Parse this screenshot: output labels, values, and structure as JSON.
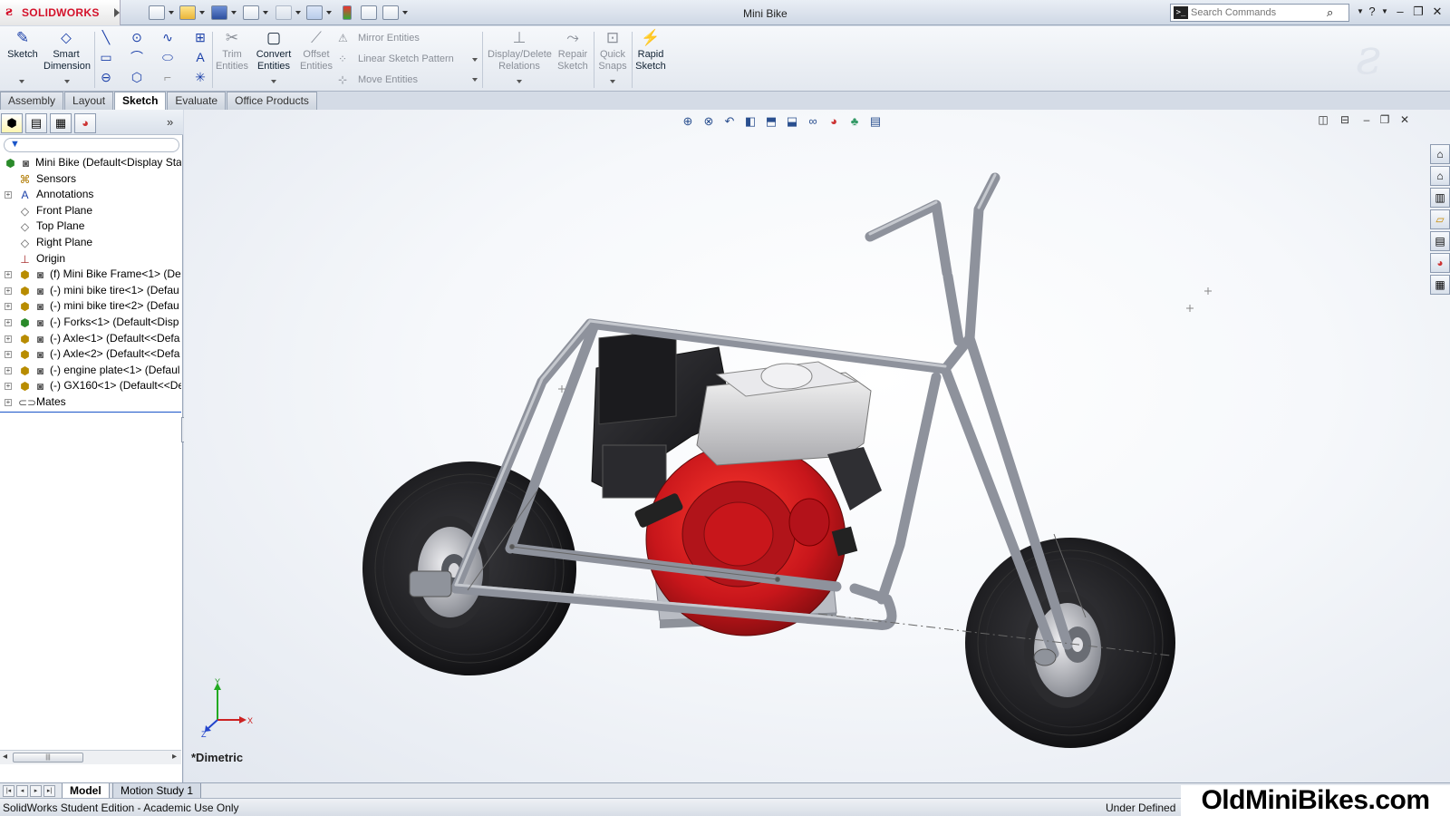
{
  "app": {
    "brand": "SOLIDWORKS",
    "brand_color": "#d4112a",
    "document_title": "Mini Bike"
  },
  "search": {
    "placeholder": "Search Commands"
  },
  "command_manager": {
    "sketch": "Sketch",
    "smart_dimension": "Smart Dimension",
    "trim_entities": "Trim Entities",
    "convert_entities": "Convert Entities",
    "offset_entities": "Offset Entities",
    "mirror_entities": "Mirror Entities",
    "linear_sketch_pattern": "Linear Sketch Pattern",
    "move_entities": "Move Entities",
    "display_delete_relations": "Display/Delete Relations",
    "repair_sketch": "Repair Sketch",
    "quick_snaps": "Quick Snaps",
    "rapid_sketch": "Rapid Sketch"
  },
  "tabs": [
    "Assembly",
    "Layout",
    "Sketch",
    "Evaluate",
    "Office Products"
  ],
  "active_tab": "Sketch",
  "tree": [
    {
      "label": "Mini Bike  (Default<Display Sta",
      "icon": "assembly-icon",
      "level": 0,
      "expandable": false
    },
    {
      "label": "Sensors",
      "icon": "sensors-icon",
      "level": 1,
      "expandable": false
    },
    {
      "label": "Annotations",
      "icon": "annotations-icon",
      "level": 1,
      "expandable": true
    },
    {
      "label": "Front Plane",
      "icon": "plane-icon",
      "level": 1,
      "expandable": false
    },
    {
      "label": "Top Plane",
      "icon": "plane-icon",
      "level": 1,
      "expandable": false
    },
    {
      "label": "Right Plane",
      "icon": "plane-icon",
      "level": 1,
      "expandable": false
    },
    {
      "label": "Origin",
      "icon": "origin-icon",
      "level": 1,
      "expandable": false
    },
    {
      "label": "(f) Mini Bike Frame<1> (De",
      "icon": "part-icon",
      "level": 1,
      "expandable": true
    },
    {
      "label": "(-) mini bike tire<1> (Defau",
      "icon": "part-icon",
      "level": 1,
      "expandable": true
    },
    {
      "label": "(-) mini bike tire<2> (Defau",
      "icon": "part-icon",
      "level": 1,
      "expandable": true
    },
    {
      "label": "(-) Forks<1> (Default<Disp",
      "icon": "subassembly-icon",
      "level": 1,
      "expandable": true
    },
    {
      "label": "(-) Axle<1> (Default<<Defa",
      "icon": "part-icon",
      "level": 1,
      "expandable": true
    },
    {
      "label": "(-) Axle<2> (Default<<Defa",
      "icon": "part-icon",
      "level": 1,
      "expandable": true
    },
    {
      "label": "(-) engine plate<1> (Defaul",
      "icon": "part-icon",
      "level": 1,
      "expandable": true
    },
    {
      "label": "(-) GX160<1> (Default<<De",
      "icon": "part-icon",
      "level": 1,
      "expandable": true
    },
    {
      "label": "Mates",
      "icon": "mates-icon",
      "level": 1,
      "expandable": true
    }
  ],
  "viewport": {
    "view_name": "*Dimetric",
    "triad": {
      "x": "X",
      "y": "Y",
      "z": "Z"
    }
  },
  "bottom_tabs": [
    "Model",
    "Motion Study 1"
  ],
  "status": {
    "left": "SolidWorks Student Edition - Academic Use Only",
    "right": "Under Defined"
  },
  "watermark": "OldMiniBikes.com",
  "colors": {
    "engine_red": "#c8161b",
    "frame_gray": "#8e929c",
    "tire_black": "#1f1f22",
    "tank_white": "#e4e4e4"
  }
}
